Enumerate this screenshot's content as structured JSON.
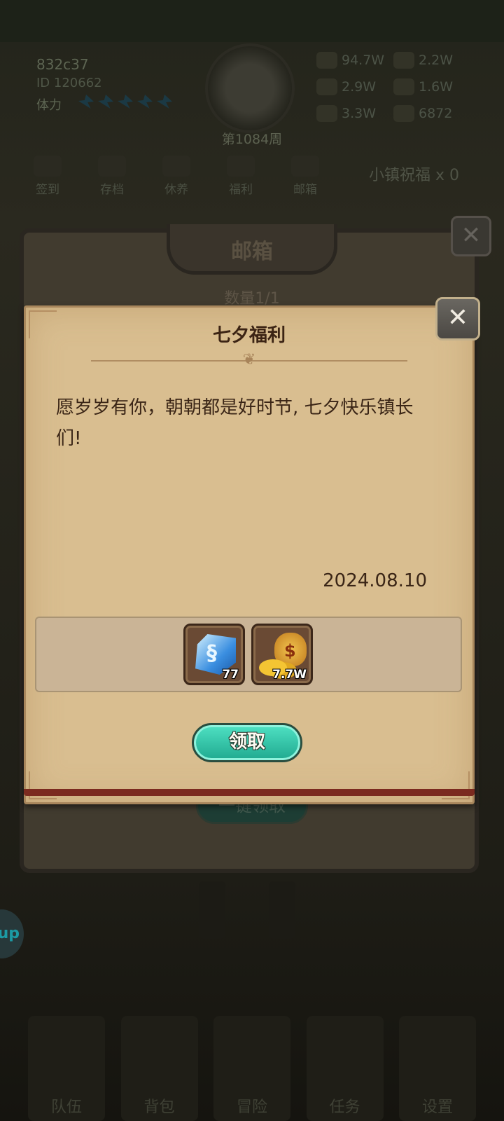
{
  "background": {
    "player": {
      "name": "832c37",
      "id": "ID 120662",
      "stamina_label": "体力"
    },
    "week": "第1084周",
    "resources": [
      {
        "icon": "gold-icon",
        "value": "94.7W"
      },
      {
        "icon": "wood-icon",
        "value": "2.2W"
      },
      {
        "icon": "stone-icon",
        "value": "2.9W"
      },
      {
        "icon": "building-icon",
        "value": "1.6W"
      },
      {
        "icon": "brick-icon",
        "value": "3.3W"
      },
      {
        "icon": "crystal-icon",
        "value": "6872"
      }
    ],
    "nav": [
      "签到",
      "存档",
      "休养",
      "福利",
      "邮箱"
    ],
    "blessing": "小镇祝福 x 0",
    "side_bubble": "up",
    "bottom_nav": [
      "队伍",
      "背包",
      "冒险",
      "任务",
      "设置"
    ]
  },
  "mailbox": {
    "title": "邮箱",
    "count": "数量1/1",
    "claim_all_label": "一键领取"
  },
  "mail": {
    "title": "七夕福利",
    "message": "愿岁岁有你，朝朝都是好时节, 七夕快乐镇长们!",
    "date": "2024.08.10",
    "attachments": [
      {
        "icon": "blue-crystal-icon",
        "quantity": "77"
      },
      {
        "icon": "gold-bag-icon",
        "quantity": "7.7W"
      }
    ],
    "claim_label": "领取"
  },
  "colors": {
    "dialog_bg": "#d9be90",
    "claim_button": "#2fc3a7",
    "text_dark": "#3a2516"
  }
}
